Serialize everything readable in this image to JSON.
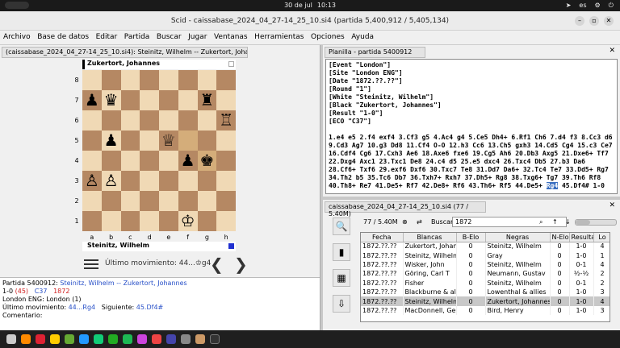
{
  "system": {
    "date": "30 de jul",
    "time": "10:13",
    "lang": "es"
  },
  "window": {
    "title": "Scid - caissabase_2024_04_27-14_25_10.si4 (partida 5,400,912 / 5,405,134)"
  },
  "menu": [
    "Archivo",
    "Base de datos",
    "Editar",
    "Partida",
    "Buscar",
    "Jugar",
    "Ventanas",
    "Herramientas",
    "Opciones",
    "Ayuda"
  ],
  "board_panel": {
    "tab": "(caissabase_2024_04_27-14_25_10.si4): Steinitz, Wilhelm -- Zukertort, Johannes",
    "top_player": "Zukertort, Johannes",
    "bottom_player": "Steinitz, Wilhelm",
    "ranks": [
      "8",
      "7",
      "6",
      "5",
      "4",
      "3",
      "2",
      "1"
    ],
    "files": [
      "a",
      "b",
      "c",
      "d",
      "e",
      "f",
      "g",
      "h"
    ],
    "last_move": "Último movimiento: 44...♔g4",
    "prev": "❮",
    "next": "❯",
    "pieces": [
      {
        "sq": "a7",
        "g": "♟"
      },
      {
        "sq": "b7",
        "g": "♛"
      },
      {
        "sq": "g7",
        "g": "♜"
      },
      {
        "sq": "h6",
        "g": "♖"
      },
      {
        "sq": "b5",
        "g": "♟"
      },
      {
        "sq": "e5",
        "g": "♕"
      },
      {
        "sq": "g4",
        "g": "♚"
      },
      {
        "sq": "f4",
        "g": "♟"
      },
      {
        "sq": "a3",
        "g": "♙"
      },
      {
        "sq": "b3",
        "g": "♙"
      },
      {
        "sq": "f1",
        "g": "♔"
      }
    ]
  },
  "info": {
    "game_label": "Partida 5400912:",
    "white": "Steinitz, Wilhelm",
    "sep": "--",
    "black": "Zukertort, Johannes",
    "result": "1-0",
    "moves_count": "(45)",
    "eco": "C37",
    "year": "1872",
    "event": "London ENG:  London (1)",
    "last_label": "Último movimiento:",
    "last_value": "44...Rg4",
    "next_label": "Siguiente:",
    "next_value": "45.Df4#",
    "comment": "Comentario:"
  },
  "pgn_panel": {
    "tab": "Planilla - partida 5400912",
    "close": "✕",
    "tags": [
      "[Event \"London\"]",
      "[Site \"London ENG\"]",
      "[Date \"1872.??.??\"]",
      "[Round \"1\"]",
      "[White \"Steinitz, Wilhelm\"]",
      "[Black \"Zukertort, Johannes\"]",
      "[Result \"1-0\"]",
      "[ECO \"C37\"]"
    ],
    "moves_before": "1.e4 e5 2.f4 exf4 3.Cf3 g5 4.Ac4 g4 5.Ce5 Dh4+ 6.Rf1 Ch6 7.d4 f3 8.Cc3 d6 9.Cd3 Ag7 10.g3 Dd8 11.Cf4 O-O 12.h3 Cc6 13.Ch5 gxh3 14.Cd5 Cg4 15.c3 Ce7 16.Cdf4 Cg6 17.Cxh3 Ae6 18.Axe6 fxe6 19.Cg5 Ah6 20.Db3 Axg5 21.Dxe6+ Tf7 22.Dxg4 Axc1 23.Txc1 De8 24.c4 d5 25.e5 dxc4 26.Txc4 Db5 27.b3 Da6 28.Cf6+ Txf6 29.exf6 Dxf6 30.Txc7 Te8 31.Dd7 Da6+ 32.Tc4 Te7 33.Dd5+ Rg7 34.Th2 b5 35.Tc6 Db7 36.Txh7+ Rxh7 37.Dh5+ Rg8 38.Txg6+ Tg7 39.Th6 Rf8 40.Th8+ Re7 41.De5+ Rf7 42.De8+ Rf6 43.Th6+ Rf5 44.De5+ ",
    "current_move": "Rg4",
    "moves_after": " 45.Df4# 1-0"
  },
  "gamelist": {
    "tab": "caissabase_2024_04_27-14_25_10.si4 (77 / 5.40M)",
    "close": "✕",
    "count": "77 / 5.40M",
    "search_label": "Buscar",
    "search_value": "1872",
    "columns": [
      "Fecha",
      "Blancas",
      "B-Elo",
      "Negras",
      "N-Elo",
      "Resulta",
      "Lo"
    ],
    "rows": [
      [
        "1872.??.??",
        "Zukertort, Johanne",
        "0",
        "Steinitz, Wilhelm",
        "0",
        "1-0",
        "4"
      ],
      [
        "1872.??.??",
        "Steinitz, Wilhelm",
        "0",
        "Gray",
        "0",
        "1-0",
        "1"
      ],
      [
        "1872.??.??",
        "Wisker, John",
        "0",
        "Steinitz, Wilhelm",
        "0",
        "0-1",
        "4"
      ],
      [
        "1872.??.??",
        "Göring, Carl T",
        "0",
        "Neumann, Gustav",
        "0",
        "½-½",
        "2"
      ],
      [
        "1872.??.??",
        "Fisher",
        "0",
        "Steinitz, Wilhelm",
        "0",
        "0-1",
        "2"
      ],
      [
        "1872.??.??",
        "Blackburne & allies",
        "0",
        "Lowenthal & allies",
        "0",
        "1-0",
        "3"
      ],
      [
        "1872.??.??",
        "Steinitz, Wilhelm",
        "0",
        "Zukertort, Johannes",
        "0",
        "1-0",
        "4"
      ],
      [
        "1872.??.??",
        "MacDonnell, Georg",
        "0",
        "Bird, Henry",
        "0",
        "1-0",
        "3"
      ]
    ]
  }
}
